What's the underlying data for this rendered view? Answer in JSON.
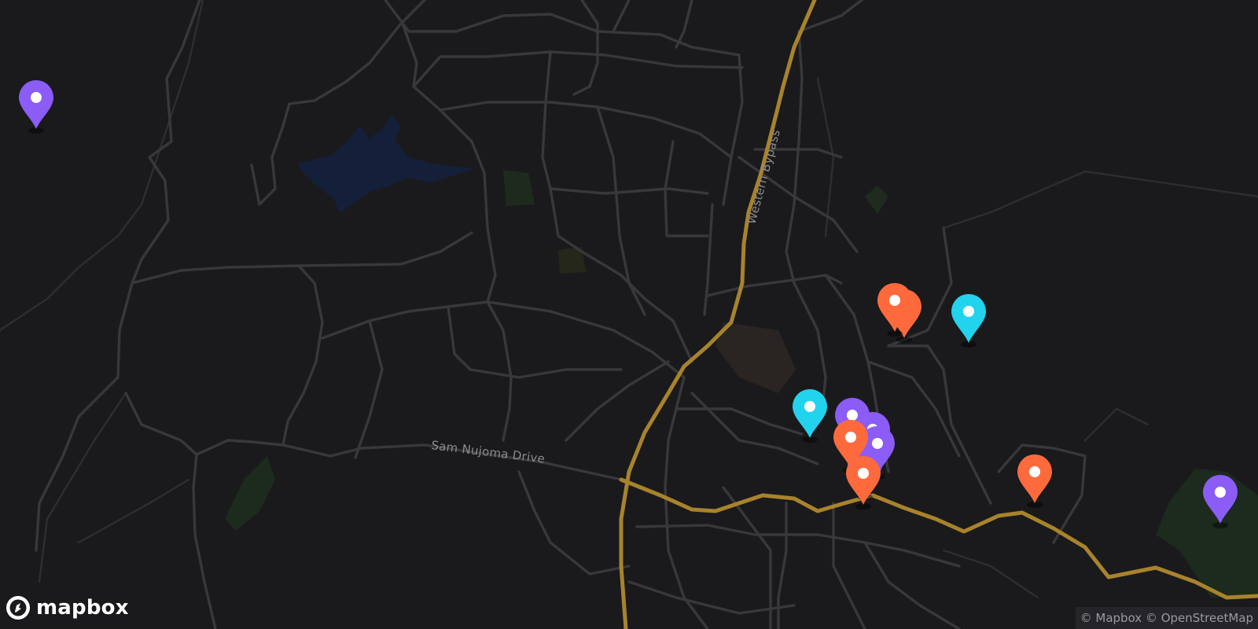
{
  "map": {
    "road_labels": [
      "Western Bypass",
      "Sam Nujoma Drive"
    ],
    "markers": [
      {
        "kind": "purple-pin",
        "color": "#8b5cf6"
      },
      {
        "kind": "orange-pin",
        "color": "#ff6a3d"
      },
      {
        "kind": "orange-pin",
        "color": "#ff6a3d"
      },
      {
        "kind": "cyan-pin",
        "color": "#22d3ee"
      },
      {
        "kind": "cyan-pin",
        "color": "#22d3ee"
      },
      {
        "kind": "purple-pin",
        "color": "#8b5cf6"
      },
      {
        "kind": "purple-pin",
        "color": "#8b5cf6"
      },
      {
        "kind": "purple-pin",
        "color": "#8b5cf6"
      },
      {
        "kind": "purple-pin",
        "color": "#8b5cf6"
      },
      {
        "kind": "orange-pin",
        "color": "#ff6a3d"
      },
      {
        "kind": "orange-pin",
        "color": "#ff6a3d"
      },
      {
        "kind": "orange-pin",
        "color": "#ff6a3d"
      },
      {
        "kind": "purple-pin",
        "color": "#8b5cf6"
      }
    ],
    "colors": {
      "background": "#1a1a1c",
      "road": "#38383c",
      "highway": "#a8832c",
      "water": "#14203a",
      "park": "#1e2a1f"
    }
  },
  "logo": {
    "text": "mapbox",
    "icon": "mapbox-logo-icon"
  },
  "attribution": {
    "text": "© Mapbox © OpenStreetMap"
  }
}
